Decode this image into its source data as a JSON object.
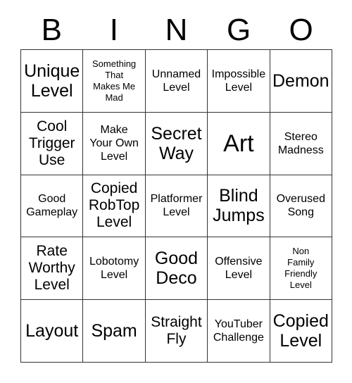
{
  "card": {
    "title_letters": [
      "B",
      "I",
      "N",
      "G",
      "O"
    ],
    "columns": 5,
    "rows": 5,
    "border_color": "#333333",
    "text_color": "#000000",
    "background_color": "#ffffff",
    "cells": [
      {
        "text": "Unique\nLevel",
        "size": "size-lg"
      },
      {
        "text": "Something\nThat\nMakes Me\nMad",
        "size": "size-xs"
      },
      {
        "text": "Unnamed\nLevel",
        "size": "size-sm"
      },
      {
        "text": "Impossible\nLevel",
        "size": "size-sm"
      },
      {
        "text": "Demon",
        "size": "size-lg"
      },
      {
        "text": "Cool\nTrigger\nUse",
        "size": "size-md"
      },
      {
        "text": "Make\nYour Own\nLevel",
        "size": "size-sm"
      },
      {
        "text": "Secret\nWay",
        "size": "size-lg"
      },
      {
        "text": "Art",
        "size": "size-xl"
      },
      {
        "text": "Stereo\nMadness",
        "size": "size-sm"
      },
      {
        "text": "Good\nGameplay",
        "size": "size-sm"
      },
      {
        "text": "Copied\nRobTop\nLevel",
        "size": "size-md"
      },
      {
        "text": "Platformer\nLevel",
        "size": "size-sm"
      },
      {
        "text": "Blind\nJumps",
        "size": "size-lg"
      },
      {
        "text": "Overused\nSong",
        "size": "size-sm"
      },
      {
        "text": "Rate\nWorthy\nLevel",
        "size": "size-md"
      },
      {
        "text": "Lobotomy\nLevel",
        "size": "size-sm"
      },
      {
        "text": "Good\nDeco",
        "size": "size-lg"
      },
      {
        "text": "Offensive\nLevel",
        "size": "size-sm"
      },
      {
        "text": "Non\nFamily\nFriendly\nLevel",
        "size": "size-xs"
      },
      {
        "text": "Layout",
        "size": "size-lg"
      },
      {
        "text": "Spam",
        "size": "size-lg"
      },
      {
        "text": "Straight\nFly",
        "size": "size-md"
      },
      {
        "text": "YouTuber\nChallenge",
        "size": "size-sm"
      },
      {
        "text": "Copied\nLevel",
        "size": "size-lg"
      }
    ]
  }
}
